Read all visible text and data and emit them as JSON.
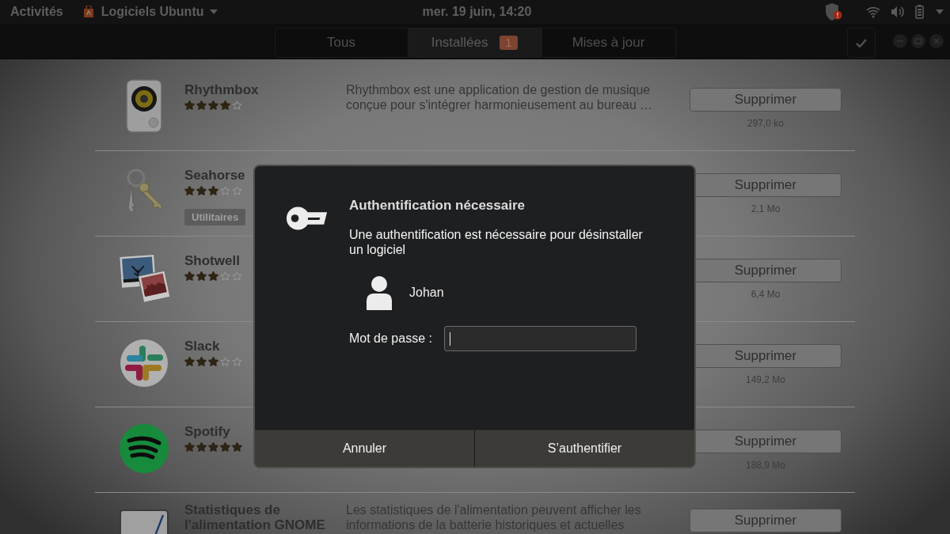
{
  "top_bar": {
    "activities": "Activités",
    "app_menu": "Logiciels Ubuntu",
    "clock": "mer. 19 juin, 14:20"
  },
  "header_bar": {
    "tabs": [
      {
        "label": "Tous",
        "selected": false
      },
      {
        "label": "Installées",
        "selected": true,
        "badge": "1"
      },
      {
        "label": "Mises à jour",
        "selected": false
      }
    ]
  },
  "apps": [
    {
      "name": "Rhythmbox",
      "stars": 4,
      "description": [
        "Rhythmbox est une application de gestion de musique",
        "conçue pour s'intégrer harmonieusement au bureau …"
      ],
      "button": "Supprimer",
      "size": "297,0 ko"
    },
    {
      "name": "Seahorse",
      "stars": 3,
      "tag": "Utilitaires",
      "button": "Supprimer",
      "size": "2,1 Mo"
    },
    {
      "name": "Shotwell",
      "stars": 3,
      "button": "Supprimer",
      "size": "6,4 Mo"
    },
    {
      "name": "Slack",
      "stars": 3,
      "button": "Supprimer",
      "size": "149,2 Mo"
    },
    {
      "name": "Spotify",
      "stars": 5,
      "button": "Supprimer",
      "size": "188,9 Mo"
    },
    {
      "name": "Statistiques de l'alimentation GNOME",
      "description": [
        "Les statistiques de l'alimentation peuvent afficher les",
        "informations de la batterie historiques et actuelles"
      ],
      "button": "Supprimer"
    }
  ],
  "dialog": {
    "title": "Authentification nécessaire",
    "message": [
      "Une authentification est nécessaire pour désinstaller",
      "un logiciel"
    ],
    "user": "Johan",
    "password_label": "Mot de passe :",
    "password_focused": true,
    "buttons": [
      "Annuler",
      "S’authentifier"
    ]
  }
}
